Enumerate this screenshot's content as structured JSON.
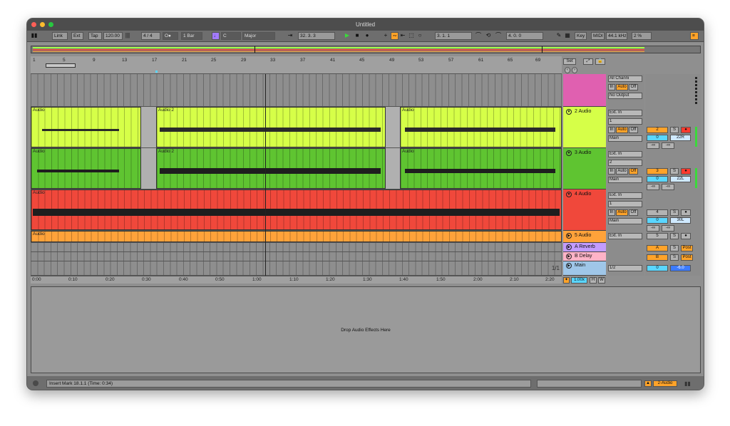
{
  "window": {
    "title": "Untitled"
  },
  "toolbar": {
    "link": "Link",
    "ext": "Ext",
    "tap": "Tap",
    "tempo": "120.00",
    "time_signature": "4 / 4",
    "metronome": "O●",
    "quantize": "1 Bar",
    "key": "C",
    "scale": "Major",
    "position": "32.  3.  3",
    "loop_start": "3.  1.  1",
    "loop_length": "4.  0.  0",
    "key_map": "Key",
    "midi_map": "MIDI",
    "sample_rate": "44.1 kHz",
    "cpu": "2 %"
  },
  "ruler": {
    "bars": [
      "1",
      "5",
      "9",
      "13",
      "17",
      "21",
      "25",
      "29",
      "33",
      "37",
      "41",
      "45",
      "49",
      "53",
      "57",
      "61",
      "65",
      "69"
    ],
    "set_label": "Set"
  },
  "time_ruler": {
    "ticks": [
      "0:00",
      "0:10",
      "0:20",
      "0:30",
      "0:40",
      "0:50",
      "1:00",
      "1:10",
      "1:20",
      "1:30",
      "1:40",
      "1:50",
      "2:00",
      "2:10",
      "2:20"
    ],
    "page": "1/1"
  },
  "tracks": [
    {
      "name": "",
      "color": "#e060b0",
      "input_type": "All Channi",
      "monitor": [
        "In",
        "Auto",
        "Off"
      ],
      "output": "No Output",
      "clips": []
    },
    {
      "name": "2 Audio",
      "color": "#d6ff48",
      "input_type": "Ext. In",
      "input_channel": "1",
      "monitor": [
        "In",
        "Auto",
        "Off"
      ],
      "output": "Main",
      "track_number": "2",
      "volume": "0",
      "pan": "22R",
      "sends": [
        "-∞",
        "-∞"
      ],
      "clips": [
        "Audio",
        "Audio 2",
        "Audio"
      ]
    },
    {
      "name": "3 Audio",
      "color": "#5fc431",
      "input_type": "Ext. In",
      "input_channel": "2",
      "monitor": [
        "In",
        "Auto",
        "Off"
      ],
      "output": "Main",
      "track_number": "3",
      "volume": "0",
      "pan": "22L",
      "sends": [
        "-∞",
        "-∞"
      ],
      "clips": [
        "Audio",
        "Audio 2",
        "Audio"
      ]
    },
    {
      "name": "4 Audio",
      "color": "#f0483b",
      "input_type": "Ext. In",
      "input_channel": "1",
      "monitor": [
        "In",
        "Auto",
        "Off"
      ],
      "output": "Main",
      "track_number": "4",
      "volume": "0",
      "pan": "30L",
      "sends": [
        "-∞",
        "-∞"
      ],
      "clips": [
        "Audio"
      ]
    },
    {
      "name": "5 Audio",
      "color": "#ffa23a",
      "input_type": "Ext. In",
      "track_number": "5",
      "clips": [
        "Audio"
      ]
    }
  ],
  "returns": [
    {
      "name": "A Reverb",
      "color": "#c39cff",
      "letter": "A",
      "post": "Post"
    },
    {
      "name": "B Delay",
      "color": "#ffb3c7",
      "letter": "B",
      "post": "Post"
    }
  ],
  "main": {
    "name": "Main",
    "output": "1/2",
    "volume": "0",
    "level": "-6.0"
  },
  "zoom": "1.00x",
  "buttons": {
    "solo": "S",
    "h": "H",
    "w": "W"
  },
  "device_area": {
    "placeholder": "Drop Audio Effects Here"
  },
  "status": {
    "message": "Insert Mark 18.1.1 (Time: 0:34)",
    "selected_track": "2-Audio"
  },
  "colors": {
    "accent": "#ffa329",
    "play": "#3bd93b",
    "cyan": "#5ad6ff"
  }
}
